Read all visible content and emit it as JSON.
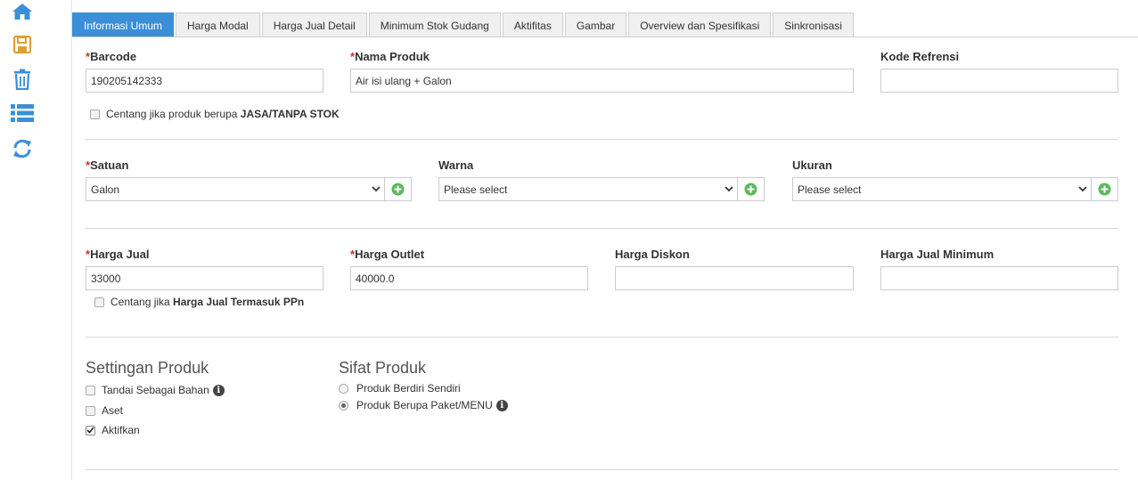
{
  "sidebar": {
    "icons": [
      "home-icon",
      "save-icon",
      "trash-icon",
      "list-icon",
      "refresh-icon"
    ]
  },
  "tabs": [
    {
      "label": "Informasi Umum",
      "active": true
    },
    {
      "label": "Harga Modal",
      "active": false
    },
    {
      "label": "Harga Jual Detail",
      "active": false
    },
    {
      "label": "Minimum Stok Gudang",
      "active": false
    },
    {
      "label": "Aktifitas",
      "active": false
    },
    {
      "label": "Gambar",
      "active": false
    },
    {
      "label": "Overview dan Spesifikasi",
      "active": false
    },
    {
      "label": "Sinkronisasi",
      "active": false
    }
  ],
  "form": {
    "required_mark": "*",
    "barcode": {
      "label": "Barcode",
      "value": "190205142333"
    },
    "nama_produk": {
      "label": "Nama Produk",
      "value": "Air isi ulang + Galon"
    },
    "kode_refrensi": {
      "label": "Kode Refrensi",
      "value": ""
    },
    "jasa_checkbox": {
      "prefix": "Centang jika produk berupa ",
      "bold": "JASA/TANPA STOK",
      "checked": false
    },
    "satuan": {
      "label": "Satuan",
      "value": "Galon"
    },
    "warna": {
      "label": "Warna",
      "value": "Please select"
    },
    "ukuran": {
      "label": "Ukuran",
      "value": "Please select"
    },
    "harga_jual": {
      "label": "Harga Jual",
      "value": "33000"
    },
    "harga_outlet": {
      "label": "Harga Outlet",
      "value": "40000.0"
    },
    "harga_diskon": {
      "label": "Harga Diskon",
      "value": ""
    },
    "harga_jual_minimum": {
      "label": "Harga Jual Minimum",
      "value": ""
    },
    "ppn_checkbox": {
      "prefix": "Centang jika ",
      "bold": "Harga Jual Termasuk PPn",
      "checked": false
    }
  },
  "settingan": {
    "title": "Settingan Produk",
    "items": [
      {
        "label": "Tandai Sebagai Bahan",
        "checked": false,
        "info": true
      },
      {
        "label": "Aset",
        "checked": false,
        "info": false
      },
      {
        "label": "Aktifkan",
        "checked": true,
        "info": false
      }
    ]
  },
  "sifat": {
    "title": "Sifat Produk",
    "options": [
      {
        "label": "Produk Berdiri Sendiri",
        "selected": false,
        "info": false
      },
      {
        "label": "Produk Berupa Paket/MENU",
        "selected": true,
        "info": true
      }
    ]
  },
  "colors": {
    "accent": "#3a8fd8",
    "save_icon": "#e0a030",
    "add_icon": "#5cb85c",
    "required": "#c9302c"
  }
}
